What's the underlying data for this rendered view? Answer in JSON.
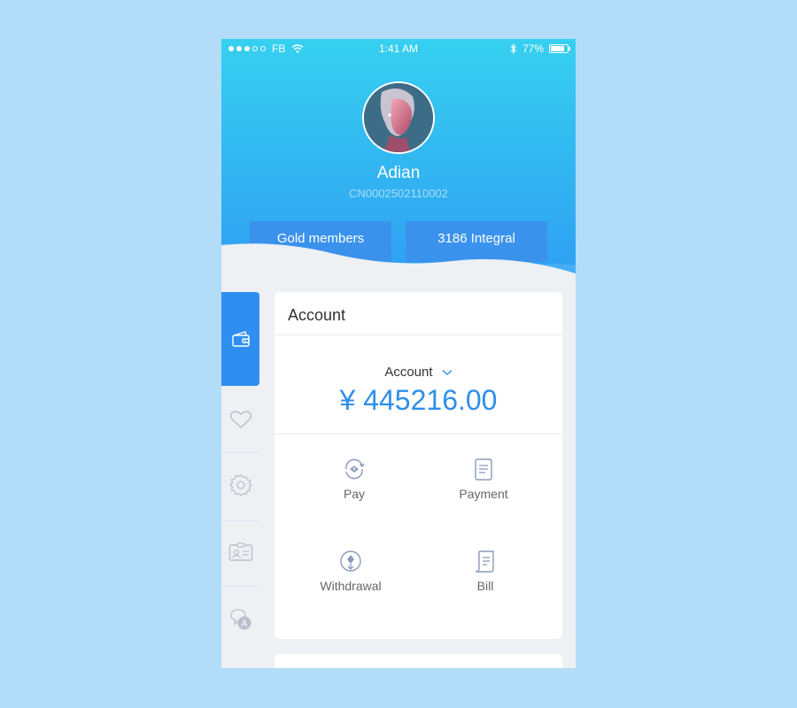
{
  "status_bar": {
    "carrier": "FB",
    "time": "1:41 AM",
    "battery": "77%"
  },
  "profile": {
    "name": "Adian",
    "id": "CN0002502110002"
  },
  "badges": {
    "membership": "Gold members",
    "integral": "3186 Integral"
  },
  "sidebar": {
    "items": [
      {
        "icon": "wallet-icon",
        "active": true
      },
      {
        "icon": "heart-icon",
        "active": false
      },
      {
        "icon": "gear-icon",
        "active": false
      },
      {
        "icon": "id-card-icon",
        "active": false
      },
      {
        "icon": "chat-icon",
        "active": false
      }
    ]
  },
  "account_card": {
    "title": "Account",
    "selector_label": "Account",
    "balance": "¥ 445216.00",
    "actions": [
      {
        "label": "Pay",
        "icon": "pay-icon"
      },
      {
        "label": "Payment",
        "icon": "document-icon"
      },
      {
        "label": "Withdrawal",
        "icon": "withdraw-icon"
      },
      {
        "label": "Bill",
        "icon": "bill-icon"
      }
    ]
  },
  "colors": {
    "accent": "#2f8fe8",
    "header_top": "#36d0f0",
    "header_bottom": "#2f9ff2",
    "background": "#b3dcf8"
  }
}
